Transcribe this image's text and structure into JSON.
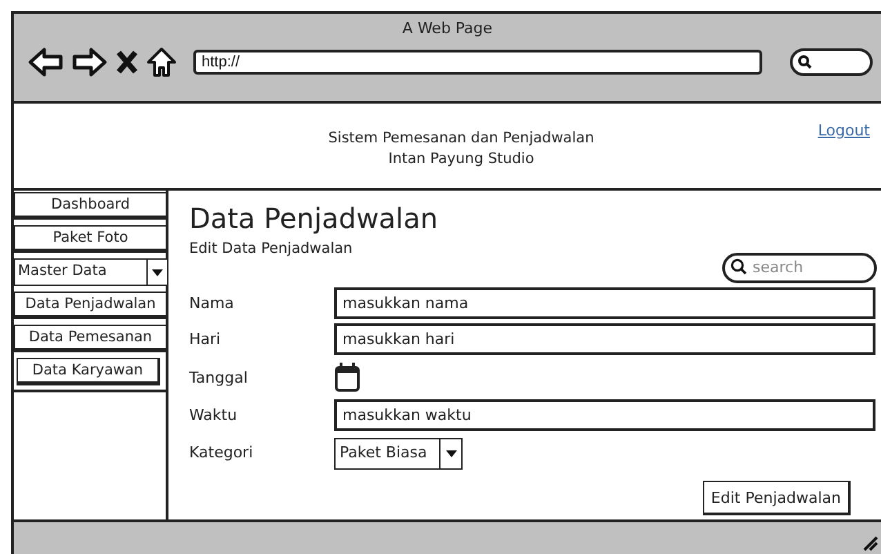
{
  "browser": {
    "title": "A Web Page",
    "address": "http://"
  },
  "header": {
    "title_lines": [
      "Sistem Pemesanan dan Penjadwalan",
      "Intan Payung Studio"
    ],
    "logout": "Logout"
  },
  "sidebar": {
    "items": [
      {
        "kind": "button",
        "label": "Dashboard"
      },
      {
        "kind": "button",
        "label": "Paket Foto"
      },
      {
        "kind": "dropdown",
        "label": "Master Data"
      },
      {
        "kind": "button",
        "label": "Data Penjadwalan"
      },
      {
        "kind": "button",
        "label": "Data Pemesanan"
      },
      {
        "kind": "button",
        "label": "Data Karyawan"
      }
    ]
  },
  "main": {
    "title": "Data Penjadwalan",
    "subtitle": "Edit Data Penjadwalan",
    "search": {
      "placeholder": "search"
    },
    "form": [
      {
        "kind": "text",
        "label": "Nama",
        "value": "masukkan nama"
      },
      {
        "kind": "text",
        "label": "Hari",
        "value": "masukkan hari"
      },
      {
        "kind": "date",
        "label": "Tanggal"
      },
      {
        "kind": "text",
        "label": "Waktu",
        "value": "masukkan waktu"
      },
      {
        "kind": "select",
        "label": "Kategori",
        "value": "Paket Biasa"
      }
    ],
    "submit": "Edit Penjadwalan"
  }
}
